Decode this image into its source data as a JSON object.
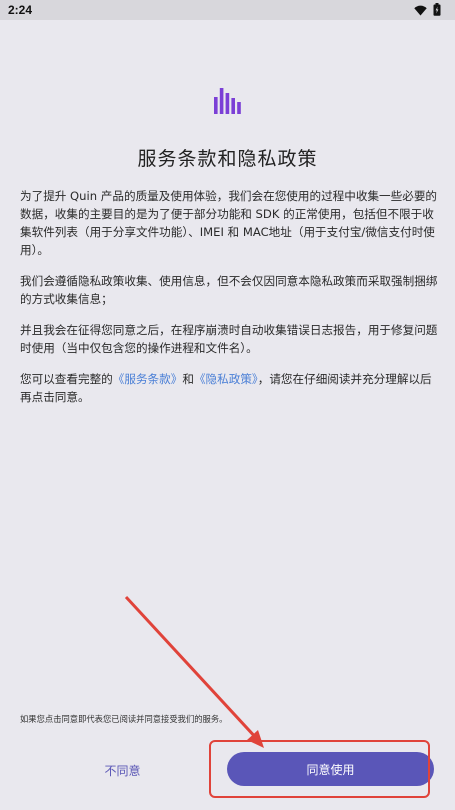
{
  "status_bar": {
    "time": "2:24",
    "icons": [
      "wifi-icon",
      "battery-icon"
    ]
  },
  "logo": {
    "icon": "bar-chart-logo-icon",
    "color": "#7b3fd6"
  },
  "dialog": {
    "title": "服务条款和隐私政策",
    "paragraph1": "为了提升 Quin 产品的质量及使用体验，我们会在您使用的过程中收集一些必要的数据，收集的主要目的是为了便于部分功能和 SDK 的正常使用，包括但不限于收集软件列表（用于分享文件功能）、IMEI 和 MAC地址（用于支付宝/微信支付时使用）。",
    "paragraph2": "我们会遵循隐私政策收集、使用信息，但不会仅因同意本隐私政策而采取强制捆绑的方式收集信息；",
    "paragraph3": "并且我会在征得您同意之后，在程序崩溃时自动收集错误日志报告，用于修复问题时使用（当中仅包含您的操作进程和文件名）。",
    "paragraph4_prefix": "您可以查看完整的",
    "terms_link": "《服务条款》",
    "paragraph4_and": "和",
    "privacy_link": "《隐私政策》",
    "paragraph4_suffix": "，请您在仔细阅读并充分理解以后再点击同意。",
    "notice": "如果您点击同意即代表您已阅读并同意接受我们的服务。"
  },
  "buttons": {
    "disagree_label": "不同意",
    "agree_label": "同意使用"
  },
  "colors": {
    "background": "#e9e8ee",
    "primary": "#5a56b8",
    "link": "#4a7fd6",
    "annotation": "#e0433a"
  }
}
